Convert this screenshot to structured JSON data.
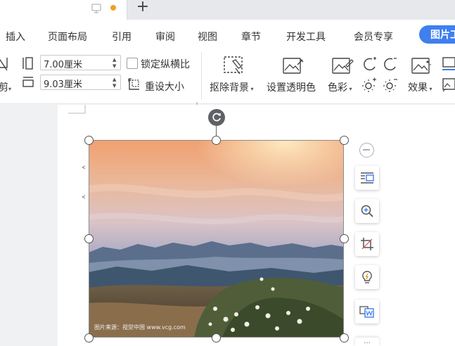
{
  "tabs": {
    "plus_label": "+",
    "modified_dot_color": "#f0a020"
  },
  "menu": {
    "items": [
      "插入",
      "页面布局",
      "引用",
      "审阅",
      "视图",
      "章节",
      "开发工具",
      "会员专享"
    ],
    "active_tab": "图片工"
  },
  "ribbon": {
    "crop_label": "剪",
    "width_value": "7.00厘米",
    "height_value": "9.03厘米",
    "lock_ratio_label": "锁定纵横比",
    "lock_ratio_checked": false,
    "reset_size_label": "重设大小",
    "remove_bg_label": "抠除背景",
    "set_transparent_label": "设置透明色",
    "color_label": "色彩",
    "effects_label": "效果"
  },
  "image": {
    "watermark": "图片来源：视觉中国 www.vcg.com"
  },
  "side_toolbar": {
    "items": [
      "layout-options-icon",
      "zoom-in-icon",
      "crop-icon",
      "lightbulb-icon",
      "convert-to-word-icon"
    ],
    "more_label": "..."
  },
  "colors": {
    "accent": "#3f7ff0"
  }
}
